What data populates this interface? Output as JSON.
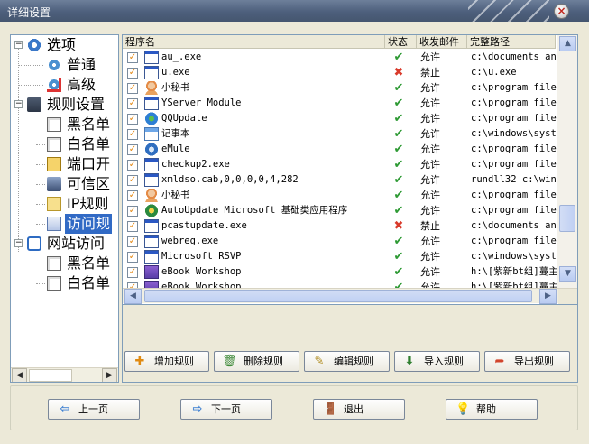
{
  "window": {
    "title": "详细设置",
    "close_label": "×"
  },
  "tree": {
    "nodes": [
      {
        "label": "选项",
        "expander": "−",
        "icon": "options-gear-icon"
      },
      {
        "label": "普通",
        "icon": "gear-star-icon"
      },
      {
        "label": "高级",
        "icon": "gear-star-red-icon"
      },
      {
        "label": "规则设置",
        "expander": "−",
        "icon": "rules-computer-icon"
      },
      {
        "label": "黑名单",
        "icon": "document-icon"
      },
      {
        "label": "白名单",
        "icon": "document-icon"
      },
      {
        "label": "端口开",
        "icon": "port-icon"
      },
      {
        "label": "可信区",
        "icon": "trusted-computer-icon"
      },
      {
        "label": "IP规则",
        "icon": "ip-rule-icon"
      },
      {
        "label": "访问规",
        "icon": "exe-icon"
      },
      {
        "label": "网站访问",
        "expander": "−",
        "icon": "ie-icon"
      },
      {
        "label": "黑名单",
        "icon": "document-icon"
      },
      {
        "label": "白名单",
        "icon": "document-icon"
      }
    ],
    "selected_index": 9
  },
  "list": {
    "columns": [
      "程序名",
      "状态",
      "收发邮件",
      "完整路径"
    ],
    "rows": [
      {
        "name": "au_.exe",
        "icon": "window-app-icon",
        "status": "allow",
        "recv": "允许",
        "path": "c:\\documents and"
      },
      {
        "name": "u.exe",
        "icon": "window-app-icon",
        "status": "deny",
        "recv": "禁止",
        "path": "c:\\u.exe"
      },
      {
        "name": "小秘书",
        "icon": "person-app-icon",
        "status": "allow",
        "recv": "允许",
        "path": "c:\\program files"
      },
      {
        "name": "YServer Module",
        "icon": "window-app-icon",
        "status": "allow",
        "recv": "允许",
        "path": "c:\\program files"
      },
      {
        "name": "QQUpdate",
        "icon": "globe-app-icon",
        "status": "allow",
        "recv": "允许",
        "path": "c:\\program files"
      },
      {
        "name": "记事本",
        "icon": "notepad-app-icon",
        "status": "allow",
        "recv": "允许",
        "path": "c:\\windows\\syste"
      },
      {
        "name": "eMule",
        "icon": "emule-app-icon",
        "status": "allow",
        "recv": "允许",
        "path": "c:\\program files"
      },
      {
        "name": "checkup2.exe",
        "icon": "window-app-icon",
        "status": "allow",
        "recv": "允许",
        "path": "c:\\program files"
      },
      {
        "name": "xmldso.cab,0,0,0,0,4,282",
        "icon": "window-app-icon",
        "status": "allow",
        "recv": "允许",
        "path": "rundll32 c:\\wind"
      },
      {
        "name": "小秘书",
        "icon": "person-app-icon",
        "status": "allow",
        "recv": "允许",
        "path": "c:\\program files"
      },
      {
        "name": "AutoUpdate Microsoft 基础类应用程序",
        "icon": "update-app-icon",
        "status": "allow",
        "recv": "允许",
        "path": "c:\\program files"
      },
      {
        "name": "pcastupdate.exe",
        "icon": "window-app-icon",
        "status": "deny",
        "recv": "禁止",
        "path": "c:\\documents and"
      },
      {
        "name": "webreg.exe",
        "icon": "window-app-icon",
        "status": "allow",
        "recv": "允许",
        "path": "c:\\program files"
      },
      {
        "name": "Microsoft RSVP",
        "icon": "window-app-icon",
        "status": "allow",
        "recv": "允许",
        "path": "c:\\windows\\syste"
      },
      {
        "name": "eBook Workshop",
        "icon": "ebook-app-icon",
        "status": "allow",
        "recv": "允许",
        "path": "h:\\[紫新bt组]蔓主"
      },
      {
        "name": "eBook Workshop",
        "icon": "ebook-app-icon",
        "status": "allow",
        "recv": "允许",
        "path": "h:\\[紫新bt组]蔓主"
      }
    ]
  },
  "actions": {
    "add": "增加规则",
    "delete": "删除规则",
    "edit": "编辑规则",
    "import": "导入规则",
    "export": "导出规则"
  },
  "nav": {
    "prev": "上一页",
    "next": "下一页",
    "exit": "退出",
    "help": "帮助"
  },
  "colors": {
    "allow": "#2e9a34",
    "deny": "#d93a2b",
    "selection": "#316ac5"
  }
}
